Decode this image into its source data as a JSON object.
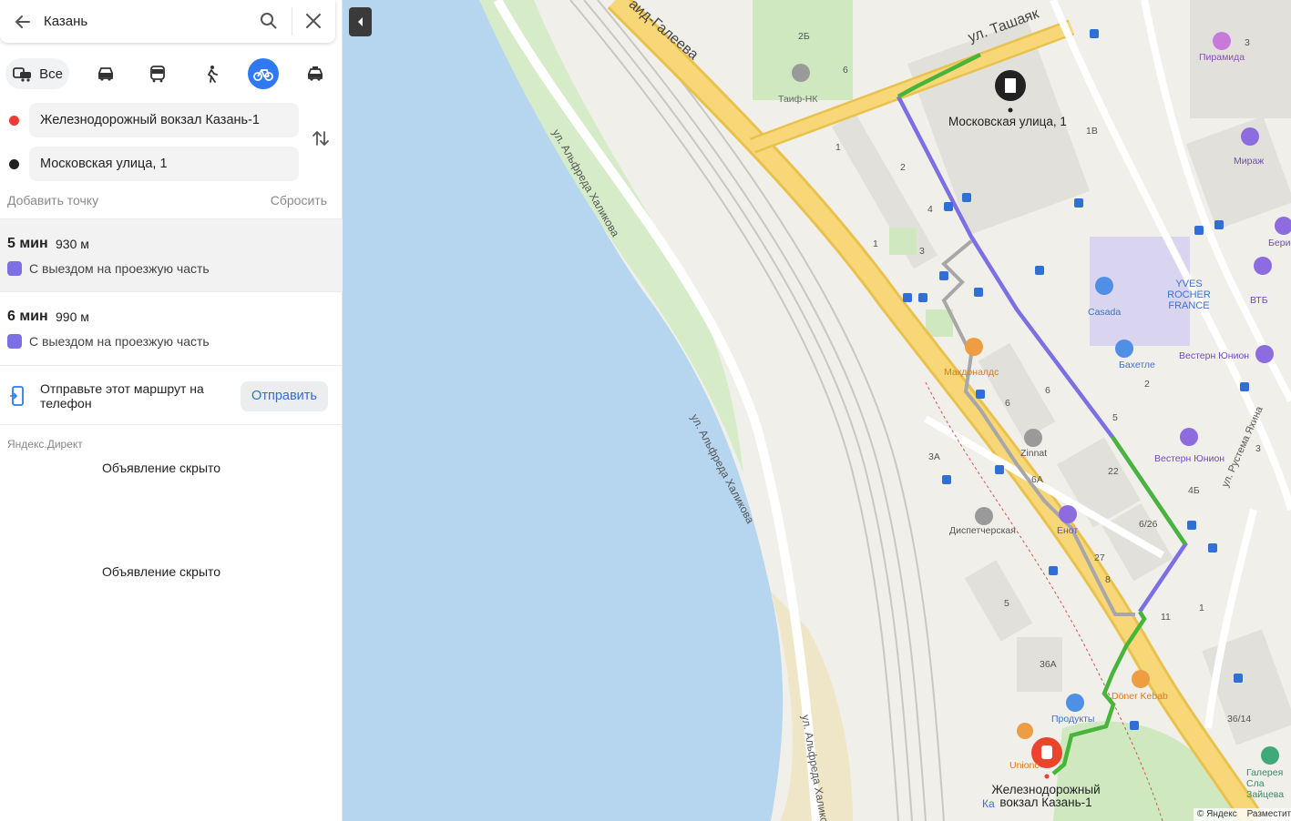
{
  "search": {
    "query": "Казань"
  },
  "modes": {
    "all_label": "Все",
    "items": [
      "car-icon",
      "bus-icon",
      "walk-icon",
      "bicycle-icon",
      "taxi-icon"
    ],
    "active": "bicycle-icon"
  },
  "points": {
    "from": "Железнодорожный вокзал Казань-1",
    "to": "Московская улица, 1",
    "add_point": "Добавить точку",
    "reset": "Сбросить"
  },
  "routes": [
    {
      "time": "5 мин",
      "distance": "930 м",
      "note": "С выездом на проезжую часть",
      "selected": true
    },
    {
      "time": "6 мин",
      "distance": "990 м",
      "note": "С выездом на проезжую часть",
      "selected": false
    }
  ],
  "send": {
    "text": "Отправьте этот маршрут на телефон",
    "button": "Отправить"
  },
  "ads": {
    "label": "Яндекс.Директ",
    "hidden1": "Объявление скрыто",
    "hidden2": "Объявление скрыто"
  },
  "map": {
    "streets": {
      "tashayak": "ул. Ташаяк",
      "galeeva": "аид-Галеева",
      "halikova1": "ул. Альфреда Халикова",
      "halikova2": "ул. Альфреда Халикова",
      "halikova3": "ул. Альфреда Халико",
      "yakhina": "ул. Рустема Яхина"
    },
    "pois": {
      "destination": "Московская улица, 1",
      "origin": "Железнодорожный вокзал Казань-1",
      "taif": "Таиф-НК",
      "piramida": "Пирамида",
      "mirazh": "Мираж",
      "beris": "Берис",
      "yves": "YVES ROCHER FRANCE",
      "vtb": "ВТБ",
      "casada": "Casada",
      "bahetle": "Бахетле",
      "western1": "Вестерн Юнион",
      "western2": "Вестерн Юнион",
      "mcd": "Макдоналдс",
      "zinnat": "Zinnat",
      "dispatch": "Диспетчерская",
      "enot": "Енот",
      "doner": "Döner Kebab",
      "produkty": "Продукты",
      "galereya": "Галерея Сла Зайцева",
      "union": "Unionc",
      "ka": "Ка"
    },
    "house_numbers": [
      "2Б",
      "6",
      "3",
      "1В",
      "1",
      "2",
      "4",
      "1",
      "3",
      "6",
      "6",
      "3А",
      "6А",
      "22",
      "6/26",
      "27",
      "8",
      "5",
      "36А",
      "11",
      "1",
      "2",
      "5",
      "4Б",
      "3",
      "36/14"
    ],
    "copyright": "© Яндекс",
    "placement": "Разместить"
  },
  "colors": {
    "accent": "#2f7af3",
    "route_bike": "#47b53a",
    "route_road": "#7b6fe4",
    "route_alt": "#a7a7a7",
    "origin_pin": "#e8452c",
    "water": "#b6d6ef",
    "road_main": "#f7d777"
  }
}
